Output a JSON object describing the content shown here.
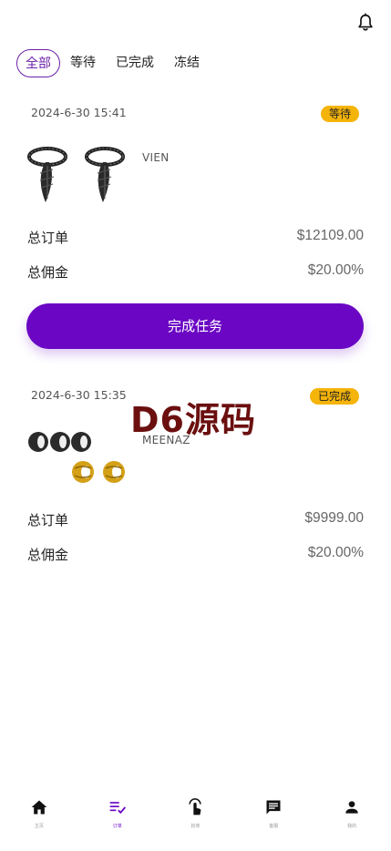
{
  "header": {
    "bell_icon": "bell-icon"
  },
  "tabs": [
    {
      "label": "全部",
      "active": true
    },
    {
      "label": "等待",
      "active": false
    },
    {
      "label": "已完成",
      "active": false
    },
    {
      "label": "冻结",
      "active": false
    }
  ],
  "orders": [
    {
      "time": "2024-6-30 15:41",
      "status": "等待",
      "status_color": "#f5b40a",
      "brand": "VIEN",
      "product_image": "feather-pendant-necklace",
      "total_order_label": "总订单",
      "total_order_value": "$12109.00",
      "total_commission_label": "总佣金",
      "total_commission_value": "$20.00%",
      "action_label": "完成任务"
    },
    {
      "time": "2024-6-30 15:35",
      "status": "已完成",
      "status_color": "#f5b40a",
      "brand": "MEENAZ",
      "product_image": "hoop-earrings",
      "total_order_label": "总订单",
      "total_order_value": "$9999.00",
      "total_commission_label": "总佣金",
      "total_commission_value": "$20.00%"
    }
  ],
  "watermark": "D6源码",
  "bottom_nav": [
    {
      "label": "主页",
      "icon": "home-icon",
      "active": false
    },
    {
      "label": "订单",
      "icon": "order-list-icon",
      "active": true
    },
    {
      "label": "抢单",
      "icon": "tap-icon",
      "active": false
    },
    {
      "label": "客服",
      "icon": "chat-icon",
      "active": false
    },
    {
      "label": "我的",
      "icon": "user-icon",
      "active": false
    }
  ],
  "colors": {
    "accent": "#6b06c4",
    "badge": "#f5b40a",
    "watermark": "#6b0f0f"
  }
}
